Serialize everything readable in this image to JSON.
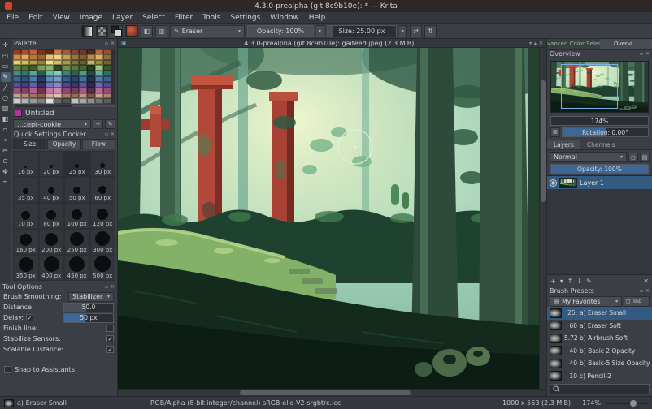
{
  "icons": {
    "close": "✕",
    "float": "▫",
    "dropdown": "▾",
    "check": "✓",
    "win_shade": "▾",
    "win_restore": "▴",
    "doc": "▣",
    "menu": "▤",
    "tag": "◻",
    "rotate": "⊞",
    "mirror_h": "⇄",
    "mirror_v": "⇅",
    "plus": "+",
    "edit": "✎"
  },
  "window": {
    "title": "4.3.0-prealpha (git 8c9b10e): * — Krita"
  },
  "menubar": {
    "items": [
      "File",
      "Edit",
      "View",
      "Image",
      "Layer",
      "Select",
      "Filter",
      "Tools",
      "Settings",
      "Window",
      "Help"
    ]
  },
  "toolbar": {
    "mid_icons": [
      "◧",
      "▥"
    ],
    "brush_editor_label": "Eraser",
    "opacity_slider": "Opacity: 100%",
    "size_slider": "Size: 25.00 px"
  },
  "toolbox": {
    "tools": [
      {
        "glyph": "✛"
      },
      {
        "glyph": "◰"
      },
      {
        "glyph": "▭"
      },
      {
        "glyph": "✎"
      },
      {
        "glyph": "╱"
      },
      {
        "glyph": "○"
      },
      {
        "glyph": "▨"
      },
      {
        "glyph": "◧"
      },
      {
        "glyph": "▫"
      },
      {
        "glyph": "⌖"
      },
      {
        "glyph": "✂"
      },
      {
        "glyph": "⊙"
      },
      {
        "glyph": "✥"
      },
      {
        "glyph": "≈"
      }
    ]
  },
  "left": {
    "palette": {
      "title": "Palette",
      "name": "Untitled",
      "combo": "...cept-cookie",
      "colors": [
        "#8f3f2c",
        "#a84f33",
        "#c2633c",
        "#7c3424",
        "#5e2a1c",
        "#cc7a48",
        "#a05c36",
        "#864830",
        "#6b3a26",
        "#4e2b1b",
        "#bb6840",
        "#935230",
        "#d68c4e",
        "#e6a65e",
        "#bd783d",
        "#a0652e",
        "#edbe75",
        "#f3cf8c",
        "#c89e5a",
        "#9a7841",
        "#7b5f35",
        "#b7884f",
        "#e0b069",
        "#8d6d3e",
        "#e5d078",
        "#d2bb60",
        "#b6a04d",
        "#94813f",
        "#f0e298",
        "#cdbe6c",
        "#a89853",
        "#82753f",
        "#685d32",
        "#c2b262",
        "#968a47",
        "#736739",
        "#5d884c",
        "#4a723e",
        "#395c32",
        "#74a15c",
        "#89b66e",
        "#2d4a29",
        "#659350",
        "#537d43",
        "#416735",
        "#273e23",
        "#9ac57f",
        "#36552e",
        "#4c8880",
        "#3a726a",
        "#5da197",
        "#2d5c56",
        "#72b6aa",
        "#86cabd",
        "#447d75",
        "#355d58",
        "#57948a",
        "#254a45",
        "#69aa9f",
        "#306e66",
        "#3c6894",
        "#2e537a",
        "#4b7da6",
        "#253e5e",
        "#5a90b8",
        "#6ca3c7",
        "#345e88",
        "#29486e",
        "#426f9a",
        "#1e354e",
        "#507da3",
        "#38618e",
        "#58518e",
        "#474178",
        "#6962a1",
        "#36325c",
        "#7b74b3",
        "#8d86c2",
        "#4f4883",
        "#3e3868",
        "#5f5894",
        "#2d294c",
        "#726ba9",
        "#544d8a",
        "#98507e",
        "#81426a",
        "#ae6192",
        "#693556",
        "#c075a4",
        "#ce88b3",
        "#8d4874",
        "#753c60",
        "#a45888",
        "#582c48",
        "#b76b9c",
        "#914e7a",
        "#c79e87",
        "#b38a72",
        "#9f765d",
        "#8a624a",
        "#d6b29c",
        "#e0c2ae",
        "#a98067",
        "#946e54",
        "#be9880",
        "#7b5842",
        "#cda68e",
        "#ae866f",
        "#cdcdcd",
        "#b3b3b3",
        "#989898",
        "#7e7e7e",
        "#e0e0e0",
        "#686868",
        "#535353",
        "#c2c2c2",
        "#a8a8a8",
        "#8e8e8e",
        "#737373",
        "#5e5e5e"
      ]
    },
    "quick": {
      "title": "Quick Settings Docker",
      "tabs": [
        "Size",
        "Opacity",
        "Flow"
      ],
      "sizes": [
        {
          "label": "16 px",
          "dot": 3
        },
        {
          "label": "20 px",
          "dot": 4
        },
        {
          "label": "25 px",
          "dot": 5
        },
        {
          "label": "30 px",
          "dot": 6
        },
        {
          "label": "35 px",
          "dot": 7
        },
        {
          "label": "40 px",
          "dot": 8
        },
        {
          "label": "50 px",
          "dot": 9
        },
        {
          "label": "60 px",
          "dot": 10
        },
        {
          "label": "70 px",
          "dot": 11
        },
        {
          "label": "80 px",
          "dot": 12
        },
        {
          "label": "100 px",
          "dot": 13
        },
        {
          "label": "120 px",
          "dot": 14
        },
        {
          "label": "160 px",
          "dot": 15
        },
        {
          "label": "200 px",
          "dot": 16
        },
        {
          "label": "250 px",
          "dot": 17
        },
        {
          "label": "300 px",
          "dot": 18
        },
        {
          "label": "350 px",
          "dot": 18
        },
        {
          "label": "400 px",
          "dot": 19
        },
        {
          "label": "450 px",
          "dot": 19
        },
        {
          "label": "500 px",
          "dot": 20
        }
      ]
    },
    "tool_options": {
      "title": "Tool Options",
      "brush_smoothing_label": "Brush Smoothing:",
      "brush_smoothing_value": "Stabilizer",
      "distance_label": "Distance:",
      "distance_value": "50.0",
      "delay_label": "Delay:",
      "delay_value": "50 px",
      "finish_label": "Finish line:",
      "stabilize_label": "Stabilize Sensors:",
      "scalable_label": "Scalable Distance:"
    },
    "snap_label": "Snap to Assistants"
  },
  "canvas": {
    "title": "4.3.0-prealpha (git 8c9b10e): gaiteed.jpeg (2.3 MiB)"
  },
  "right": {
    "tabs": [
      "Advanced Color Selec...",
      "Overvi..."
    ],
    "overview": {
      "title": "Overview",
      "zoom": "174%",
      "rotation": "Rotation: 0.00°"
    },
    "layers": {
      "tabs": [
        "Layers",
        "Channels"
      ],
      "blend_mode": "Normal",
      "opacity": "Opacity: 100%",
      "items": [
        {
          "name": "Layer 1"
        }
      ],
      "footer_icons": [
        "+",
        "▾",
        "↑",
        "↓",
        "✎"
      ],
      "delete_icon": "✕"
    },
    "brush_presets": {
      "title": "Brush Presets",
      "favorites": "My Favorites",
      "tag": "Tag",
      "items": [
        {
          "num": "25.",
          "name": "a) Eraser Small"
        },
        {
          "num": "60",
          "name": "a) Eraser Soft"
        },
        {
          "num": "5.72",
          "name": "b) Airbrush Soft"
        },
        {
          "num": "40",
          "name": "b) Basic 2 Opacity"
        },
        {
          "num": "40",
          "name": "b) Basic-5 Size Opacity"
        },
        {
          "num": "10",
          "name": "c) Pencil-2"
        }
      ]
    }
  },
  "statusbar": {
    "brush": "a) Eraser Small",
    "profile": "RGB/Alpha (8-bit integer/channel)  sRGB-elle-V2-srgbtrc.icc",
    "doc_size": "1000 x 563 (2.3 MiB)",
    "zoom": "174%"
  }
}
